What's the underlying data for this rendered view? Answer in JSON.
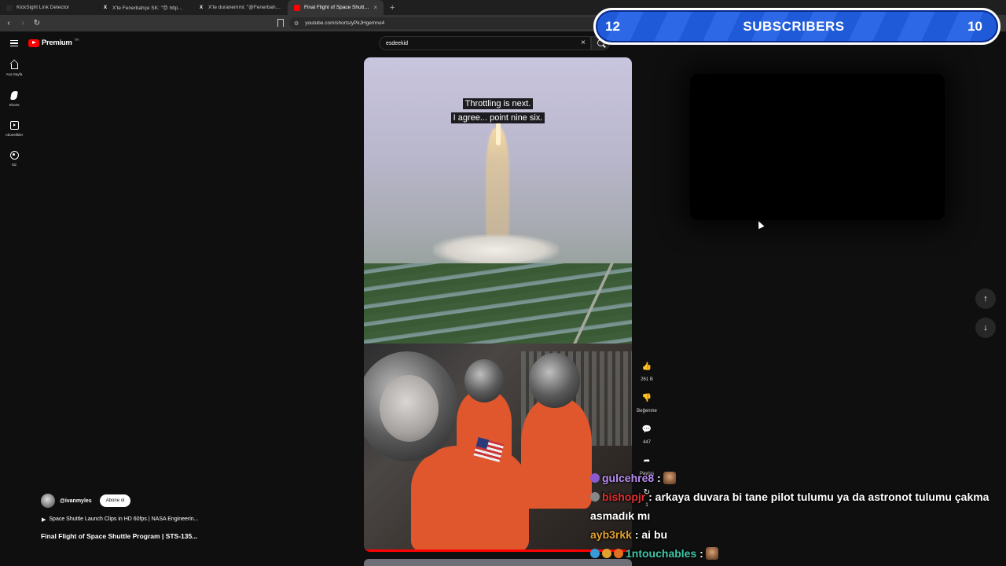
{
  "browser": {
    "tabs": [
      {
        "title": "KickSight Link Detector",
        "favicon": "",
        "active": false
      },
      {
        "title": "X'te Fenerbahçe SK: \"😍 https://t.co/",
        "favicon": "X",
        "active": false
      },
      {
        "title": "X'te duranemmi: \"@Fenerbahce http",
        "favicon": "X",
        "active": false
      },
      {
        "title": "Final Flight of Space Shuttle P",
        "favicon": "yt",
        "active": true
      }
    ],
    "new_tab": "+",
    "url": "youtube.com/shorts/yPkJHgemno4"
  },
  "youtube": {
    "logo_text": "Premium",
    "logo_region": "TR",
    "search_value": "esdeekid",
    "guide": [
      {
        "label": "Ana Sayfa",
        "icon": "home-icon"
      },
      {
        "label": "Shorts",
        "icon": "shorts-icon"
      },
      {
        "label": "Abonelikler",
        "icon": "subscriptions-icon"
      },
      {
        "label": "Siz",
        "icon": "you-icon"
      }
    ]
  },
  "video": {
    "captions": [
      "Throttling is next.",
      "I agree... point nine six."
    ],
    "progress": 1.0
  },
  "actions": [
    {
      "icon": "like-icon",
      "glyph": "👍",
      "label": "261 B"
    },
    {
      "icon": "dislike-icon",
      "glyph": "👎",
      "label": "Beğenme"
    },
    {
      "icon": "comment-icon",
      "glyph": "💬",
      "label": "447"
    },
    {
      "icon": "share-icon",
      "glyph": "➦",
      "label": "Paylaş"
    },
    {
      "icon": "remix-icon",
      "glyph": "↻",
      "label": "1"
    }
  ],
  "channel": {
    "handle": "@ivanmyles",
    "subscribe_label": "Abone ol",
    "related": "Space Shuttle Launch Clips in HD 60fps | NASA Engineerin...",
    "related_prefix": "▶",
    "title": "Final Flight of Space Shuttle Program | STS-135..."
  },
  "nav": {
    "up": "↑",
    "down": "↓"
  },
  "overlay": {
    "left_count": "12",
    "label": "SUBSCRIBERS",
    "right_count": "10"
  },
  "chat": [
    {
      "user": "gulcehre8",
      "color": "#b98cf2",
      "sep": " :",
      "message": ""
    },
    {
      "user": "bishopjr",
      "color": "#e03030",
      "sep": " :",
      "message": " arkaya duvara bi tane pilot tulumu ya da astronot tulumu çakma asmadık mı"
    },
    {
      "user": "ayb3rkk",
      "color": "#e0a030",
      "sep": " :",
      "message": " ai bu"
    },
    {
      "user": "1ntouchables",
      "color": "#3fc6a8",
      "sep": " :",
      "message": ""
    }
  ]
}
